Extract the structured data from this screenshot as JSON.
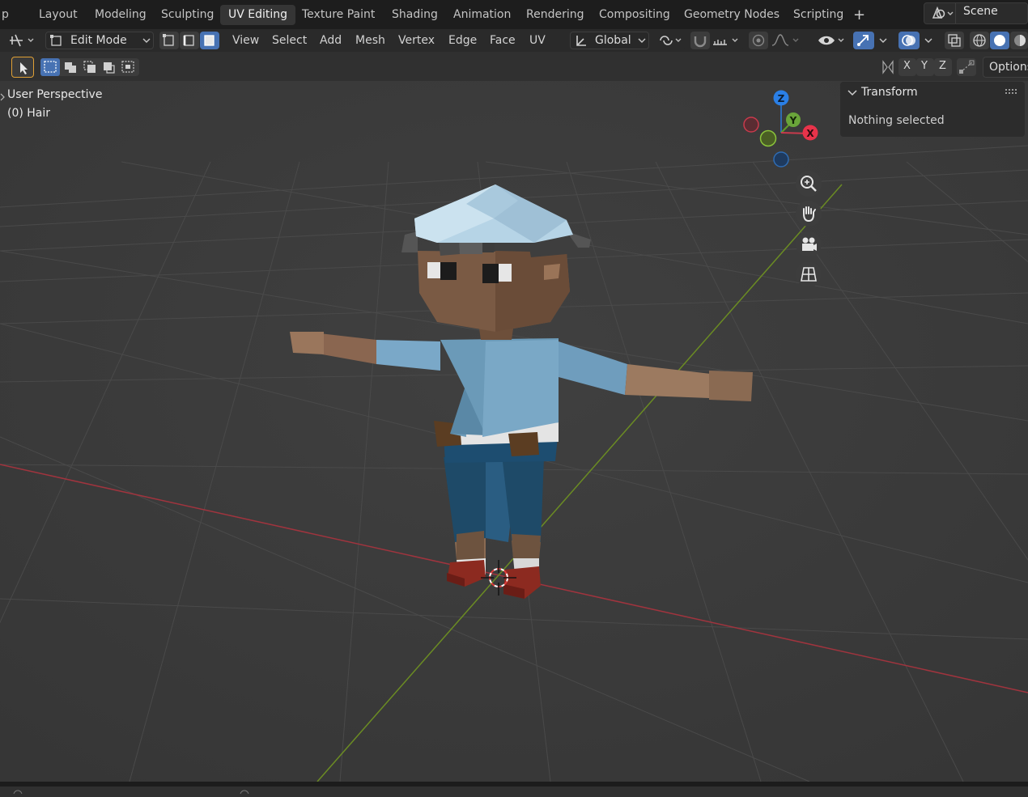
{
  "workspace_tabs": [
    "Layout",
    "Modeling",
    "Sculpting",
    "UV Editing",
    "Texture Paint",
    "Shading",
    "Animation",
    "Rendering",
    "Compositing",
    "Geometry Nodes",
    "Scripting"
  ],
  "active_tab": "UV Editing",
  "cut_menu_fragment": "p",
  "add_workspace": "+",
  "scene": {
    "label": "Scene"
  },
  "header": {
    "mode": "Edit Mode",
    "menus": [
      "View",
      "Select",
      "Add",
      "Mesh",
      "Vertex",
      "Edge",
      "Face",
      "UV"
    ],
    "orientation": "Global"
  },
  "axes_toggle": [
    "X",
    "Y",
    "Z"
  ],
  "options_label": "Options",
  "viewport": {
    "view_name": "User Perspective",
    "object_name": "(0) Hair"
  },
  "npanel": {
    "title": "Transform",
    "message": "Nothing selected"
  },
  "gizmo": {
    "z": "Z",
    "y": "Y",
    "x": "X"
  },
  "colors": {
    "accent": "#4772b3",
    "x_axis": "#ff3352",
    "y_axis": "#8bdc00",
    "z_axis": "#2890ff"
  }
}
